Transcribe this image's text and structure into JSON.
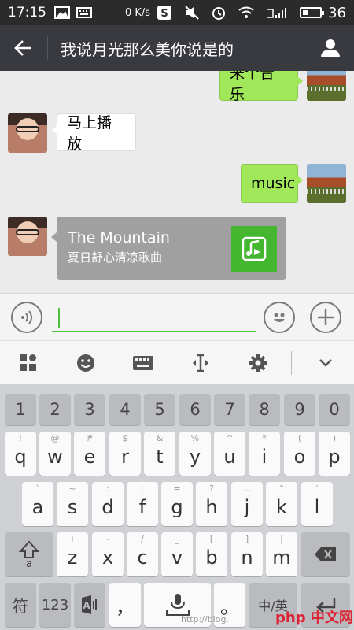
{
  "status_bar": {
    "time": "17:15",
    "network_speed": "0 K/s",
    "battery": "36",
    "battery_fraction": 0.36
  },
  "header": {
    "back_icon": "arrow-left-icon",
    "title": "我说月光那么美你说是的",
    "profile_icon": "person-icon"
  },
  "chat": {
    "messages": [
      {
        "side": "right",
        "type": "text",
        "text": "来个音乐"
      },
      {
        "side": "left",
        "type": "text",
        "text": "马上播放"
      },
      {
        "side": "right",
        "type": "text",
        "text": "music"
      },
      {
        "side": "left",
        "type": "music",
        "title": "The Mountain",
        "subtitle": "夏日舒心清凉歌曲"
      }
    ]
  },
  "input_bar": {
    "voice_icon": "voice-icon",
    "emoji_icon": "emoji-icon",
    "plus_icon": "plus-icon",
    "value": ""
  },
  "ime_toolbar": {
    "icons": [
      "apps-icon",
      "emoji-icon",
      "keyboard-icon",
      "cursor-icon",
      "settings-icon",
      "collapse-icon"
    ]
  },
  "keyboard": {
    "number_row": [
      "1",
      "2",
      "3",
      "4",
      "5",
      "6",
      "7",
      "8",
      "9",
      "0"
    ],
    "row1": [
      [
        "q",
        "!"
      ],
      [
        "w",
        "@"
      ],
      [
        "e",
        "#"
      ],
      [
        "r",
        "$"
      ],
      [
        "t",
        "&"
      ],
      [
        "y",
        "%"
      ],
      [
        "u",
        "^"
      ],
      [
        "i",
        "*"
      ],
      [
        "o",
        "("
      ],
      [
        "p",
        ")"
      ]
    ],
    "row2": [
      [
        "a",
        "`"
      ],
      [
        "s",
        "~"
      ],
      [
        "d",
        ":"
      ],
      [
        "f",
        ";"
      ],
      [
        "g",
        "="
      ],
      [
        "h",
        "?"
      ],
      [
        "j",
        "…"
      ],
      [
        "k",
        "\""
      ],
      [
        "l",
        "'"
      ]
    ],
    "row3": [
      [
        "z",
        "+"
      ],
      [
        "x",
        "-"
      ],
      [
        "c",
        "/"
      ],
      [
        "v",
        "_"
      ],
      [
        "b",
        "["
      ],
      [
        "n",
        "]"
      ],
      [
        "m",
        "|"
      ]
    ],
    "bottom": {
      "symbol": "符",
      "numbers": "123",
      "comma": "，",
      "period": "。",
      "lang": "中/英"
    }
  },
  "watermark": {
    "text": "http://blog.",
    "logo": "php 中文网"
  },
  "colors": {
    "header_bg": "#393a3f",
    "bubble_green": "#a0e75a",
    "music_icon_green": "#44b62f",
    "input_accent": "#4ec23a"
  }
}
